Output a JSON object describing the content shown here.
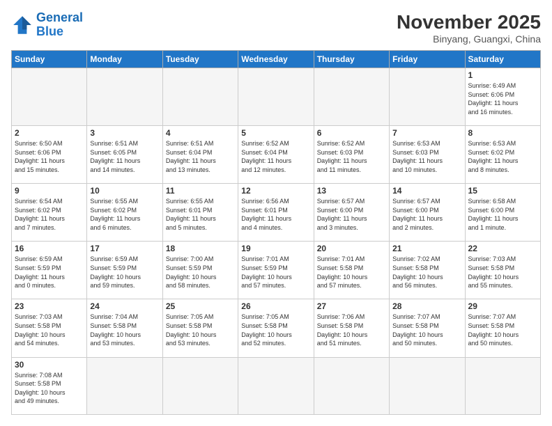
{
  "header": {
    "logo_general": "General",
    "logo_blue": "Blue",
    "month_title": "November 2025",
    "location": "Binyang, Guangxi, China"
  },
  "weekdays": [
    "Sunday",
    "Monday",
    "Tuesday",
    "Wednesday",
    "Thursday",
    "Friday",
    "Saturday"
  ],
  "days": {
    "d1": {
      "num": "1",
      "info": "Sunrise: 6:49 AM\nSunset: 6:06 PM\nDaylight: 11 hours\nand 16 minutes."
    },
    "d2": {
      "num": "2",
      "info": "Sunrise: 6:50 AM\nSunset: 6:06 PM\nDaylight: 11 hours\nand 15 minutes."
    },
    "d3": {
      "num": "3",
      "info": "Sunrise: 6:51 AM\nSunset: 6:05 PM\nDaylight: 11 hours\nand 14 minutes."
    },
    "d4": {
      "num": "4",
      "info": "Sunrise: 6:51 AM\nSunset: 6:04 PM\nDaylight: 11 hours\nand 13 minutes."
    },
    "d5": {
      "num": "5",
      "info": "Sunrise: 6:52 AM\nSunset: 6:04 PM\nDaylight: 11 hours\nand 12 minutes."
    },
    "d6": {
      "num": "6",
      "info": "Sunrise: 6:52 AM\nSunset: 6:03 PM\nDaylight: 11 hours\nand 11 minutes."
    },
    "d7": {
      "num": "7",
      "info": "Sunrise: 6:53 AM\nSunset: 6:03 PM\nDaylight: 11 hours\nand 10 minutes."
    },
    "d8": {
      "num": "8",
      "info": "Sunrise: 6:53 AM\nSunset: 6:02 PM\nDaylight: 11 hours\nand 8 minutes."
    },
    "d9": {
      "num": "9",
      "info": "Sunrise: 6:54 AM\nSunset: 6:02 PM\nDaylight: 11 hours\nand 7 minutes."
    },
    "d10": {
      "num": "10",
      "info": "Sunrise: 6:55 AM\nSunset: 6:02 PM\nDaylight: 11 hours\nand 6 minutes."
    },
    "d11": {
      "num": "11",
      "info": "Sunrise: 6:55 AM\nSunset: 6:01 PM\nDaylight: 11 hours\nand 5 minutes."
    },
    "d12": {
      "num": "12",
      "info": "Sunrise: 6:56 AM\nSunset: 6:01 PM\nDaylight: 11 hours\nand 4 minutes."
    },
    "d13": {
      "num": "13",
      "info": "Sunrise: 6:57 AM\nSunset: 6:00 PM\nDaylight: 11 hours\nand 3 minutes."
    },
    "d14": {
      "num": "14",
      "info": "Sunrise: 6:57 AM\nSunset: 6:00 PM\nDaylight: 11 hours\nand 2 minutes."
    },
    "d15": {
      "num": "15",
      "info": "Sunrise: 6:58 AM\nSunset: 6:00 PM\nDaylight: 11 hours\nand 1 minute."
    },
    "d16": {
      "num": "16",
      "info": "Sunrise: 6:59 AM\nSunset: 5:59 PM\nDaylight: 11 hours\nand 0 minutes."
    },
    "d17": {
      "num": "17",
      "info": "Sunrise: 6:59 AM\nSunset: 5:59 PM\nDaylight: 10 hours\nand 59 minutes."
    },
    "d18": {
      "num": "18",
      "info": "Sunrise: 7:00 AM\nSunset: 5:59 PM\nDaylight: 10 hours\nand 58 minutes."
    },
    "d19": {
      "num": "19",
      "info": "Sunrise: 7:01 AM\nSunset: 5:59 PM\nDaylight: 10 hours\nand 57 minutes."
    },
    "d20": {
      "num": "20",
      "info": "Sunrise: 7:01 AM\nSunset: 5:58 PM\nDaylight: 10 hours\nand 57 minutes."
    },
    "d21": {
      "num": "21",
      "info": "Sunrise: 7:02 AM\nSunset: 5:58 PM\nDaylight: 10 hours\nand 56 minutes."
    },
    "d22": {
      "num": "22",
      "info": "Sunrise: 7:03 AM\nSunset: 5:58 PM\nDaylight: 10 hours\nand 55 minutes."
    },
    "d23": {
      "num": "23",
      "info": "Sunrise: 7:03 AM\nSunset: 5:58 PM\nDaylight: 10 hours\nand 54 minutes."
    },
    "d24": {
      "num": "24",
      "info": "Sunrise: 7:04 AM\nSunset: 5:58 PM\nDaylight: 10 hours\nand 53 minutes."
    },
    "d25": {
      "num": "25",
      "info": "Sunrise: 7:05 AM\nSunset: 5:58 PM\nDaylight: 10 hours\nand 53 minutes."
    },
    "d26": {
      "num": "26",
      "info": "Sunrise: 7:05 AM\nSunset: 5:58 PM\nDaylight: 10 hours\nand 52 minutes."
    },
    "d27": {
      "num": "27",
      "info": "Sunrise: 7:06 AM\nSunset: 5:58 PM\nDaylight: 10 hours\nand 51 minutes."
    },
    "d28": {
      "num": "28",
      "info": "Sunrise: 7:07 AM\nSunset: 5:58 PM\nDaylight: 10 hours\nand 50 minutes."
    },
    "d29": {
      "num": "29",
      "info": "Sunrise: 7:07 AM\nSunset: 5:58 PM\nDaylight: 10 hours\nand 50 minutes."
    },
    "d30": {
      "num": "30",
      "info": "Sunrise: 7:08 AM\nSunset: 5:58 PM\nDaylight: 10 hours\nand 49 minutes."
    }
  }
}
